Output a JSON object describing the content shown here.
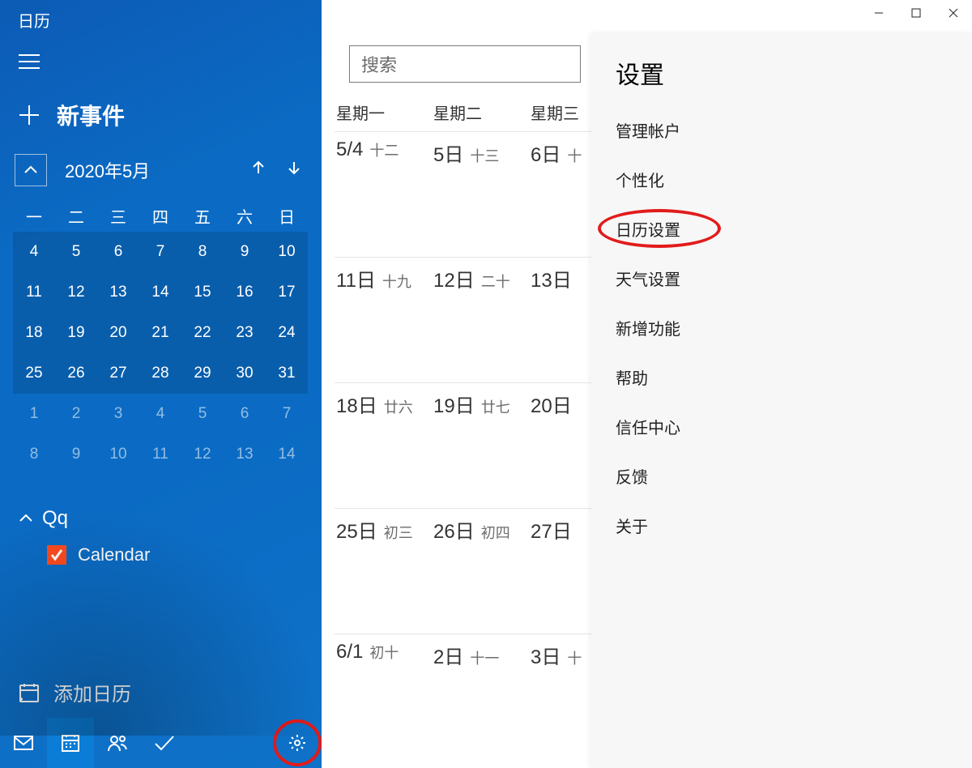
{
  "app": {
    "title": "日历"
  },
  "sidebar": {
    "new_event": "新事件",
    "month_label": "2020年5月",
    "weekdays": [
      "一",
      "二",
      "三",
      "四",
      "五",
      "六",
      "日"
    ],
    "mini": [
      [
        {
          "n": "4"
        },
        {
          "n": "5"
        },
        {
          "n": "6"
        },
        {
          "n": "7",
          "today": true
        },
        {
          "n": "8"
        },
        {
          "n": "9"
        },
        {
          "n": "10"
        }
      ],
      [
        {
          "n": "11"
        },
        {
          "n": "12"
        },
        {
          "n": "13"
        },
        {
          "n": "14"
        },
        {
          "n": "15"
        },
        {
          "n": "16"
        },
        {
          "n": "17"
        }
      ],
      [
        {
          "n": "18"
        },
        {
          "n": "19"
        },
        {
          "n": "20"
        },
        {
          "n": "21"
        },
        {
          "n": "22"
        },
        {
          "n": "23"
        },
        {
          "n": "24"
        }
      ],
      [
        {
          "n": "25"
        },
        {
          "n": "26"
        },
        {
          "n": "27"
        },
        {
          "n": "28"
        },
        {
          "n": "29"
        },
        {
          "n": "30"
        },
        {
          "n": "31"
        }
      ],
      [
        {
          "n": "1",
          "other": true
        },
        {
          "n": "2",
          "other": true
        },
        {
          "n": "3",
          "other": true
        },
        {
          "n": "4",
          "other": true
        },
        {
          "n": "5",
          "other": true
        },
        {
          "n": "6",
          "other": true
        },
        {
          "n": "7",
          "other": true
        }
      ],
      [
        {
          "n": "8",
          "other": true
        },
        {
          "n": "9",
          "other": true
        },
        {
          "n": "10",
          "other": true
        },
        {
          "n": "11",
          "other": true
        },
        {
          "n": "12",
          "other": true
        },
        {
          "n": "13",
          "other": true
        },
        {
          "n": "14",
          "other": true
        }
      ]
    ],
    "account": "Qq",
    "calendar_item": "Calendar",
    "add_calendar": "添加日历"
  },
  "search": {
    "placeholder": "搜索"
  },
  "week_headers": [
    "星期一",
    "星期二",
    "星期三"
  ],
  "grid": [
    [
      {
        "d": "5/4",
        "l": "十二"
      },
      {
        "d": "5日",
        "l": "十三"
      },
      {
        "d": "6日",
        "l": "十"
      }
    ],
    [
      {
        "d": "11日",
        "l": "十九"
      },
      {
        "d": "12日",
        "l": "二十"
      },
      {
        "d": "13日",
        "l": ""
      }
    ],
    [
      {
        "d": "18日",
        "l": "廿六"
      },
      {
        "d": "19日",
        "l": "廿七"
      },
      {
        "d": "20日",
        "l": ""
      }
    ],
    [
      {
        "d": "25日",
        "l": "初三"
      },
      {
        "d": "26日",
        "l": "初四"
      },
      {
        "d": "27日",
        "l": ""
      }
    ],
    [
      {
        "d": "6/1",
        "l": "初十"
      },
      {
        "d": "2日",
        "l": "十一"
      },
      {
        "d": "3日",
        "l": "十"
      }
    ]
  ],
  "settings": {
    "title": "设置",
    "items": [
      "管理帐户",
      "个性化",
      "日历设置",
      "天气设置",
      "新增功能",
      "帮助",
      "信任中心",
      "反馈",
      "关于"
    ],
    "highlight_index": 2
  }
}
